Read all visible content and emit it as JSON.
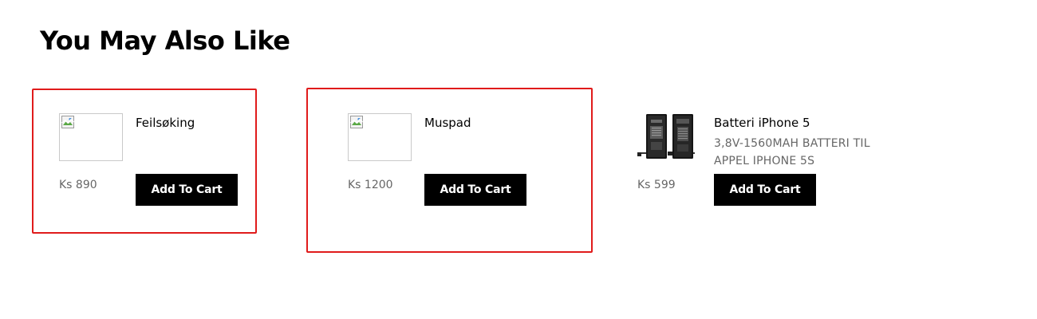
{
  "section": {
    "title": "You May Also Like"
  },
  "products": [
    {
      "name": "Feilsøking",
      "price": "Ks 890",
      "button_label": "Add To Cart",
      "image": "broken-image-icon"
    },
    {
      "name": "Muspad",
      "price": "Ks 1200",
      "button_label": "Add To Cart",
      "image": "broken-image-icon"
    },
    {
      "name": "Batteri iPhone 5",
      "description": "3,8V-1560MAH BATTERI TIL APPEL IPHONE 5S",
      "price": "Ks 599",
      "button_label": "Add To Cart",
      "image": "battery-image"
    }
  ],
  "colors": {
    "highlight": "#e01b1b",
    "button_bg": "#000000",
    "button_text": "#ffffff",
    "price_text": "#666666"
  }
}
